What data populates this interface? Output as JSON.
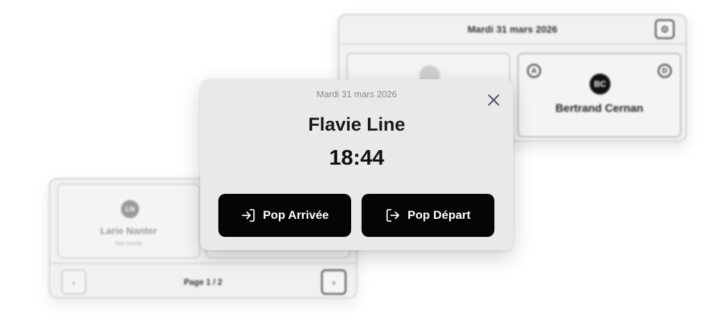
{
  "back_card": {
    "header_date": "Mardi 31 mars 2026",
    "settings_icon": "gear-icon",
    "tile": {
      "avatar_initials": "BC",
      "name": "Bertrand Cernan",
      "badge_left": "A",
      "badge_right": "D"
    }
  },
  "left_card": {
    "tile": {
      "avatar_initials": "LN",
      "name": "Larie Nanter",
      "subtitle": "Non pointé"
    },
    "pager": {
      "label": "Page 1 / 2",
      "prev_icon": "chevron-left-icon",
      "next_icon": "chevron-right-icon"
    }
  },
  "modal": {
    "date": "Mardi 31 mars 2026",
    "name": "Flavie Line",
    "time": "18:44",
    "close_icon": "close-icon",
    "arrive_label": "Pop Arrivée",
    "arrive_icon": "log-in-icon",
    "depart_label": "Pop Départ",
    "depart_icon": "log-out-icon"
  }
}
